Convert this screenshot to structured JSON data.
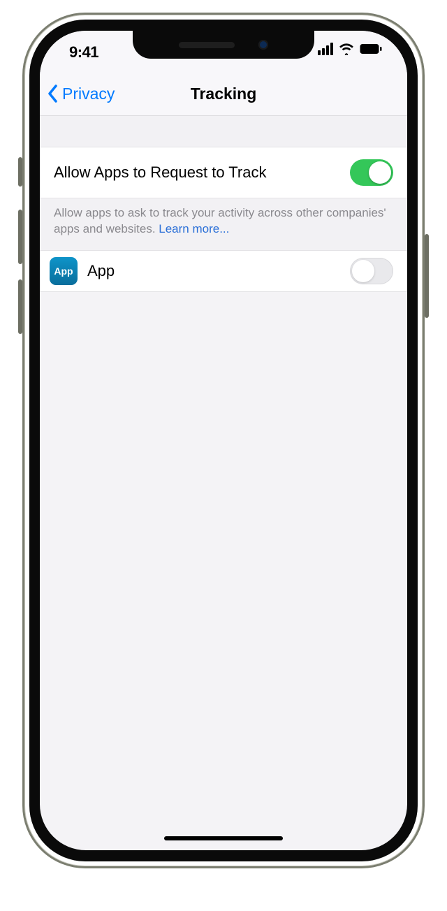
{
  "statusbar": {
    "time": "9:41"
  },
  "nav": {
    "back_label": "Privacy",
    "title": "Tracking"
  },
  "main": {
    "allow_tracking": {
      "label": "Allow Apps to Request to Track",
      "enabled": true
    },
    "description": "Allow apps to ask to track your activity across other companies' apps and websites. ",
    "learn_more": "Learn more...",
    "apps": [
      {
        "name": "App",
        "icon_text": "App",
        "enabled": false
      }
    ]
  },
  "colors": {
    "ios_blue": "#007aff",
    "ios_green": "#34c759"
  }
}
